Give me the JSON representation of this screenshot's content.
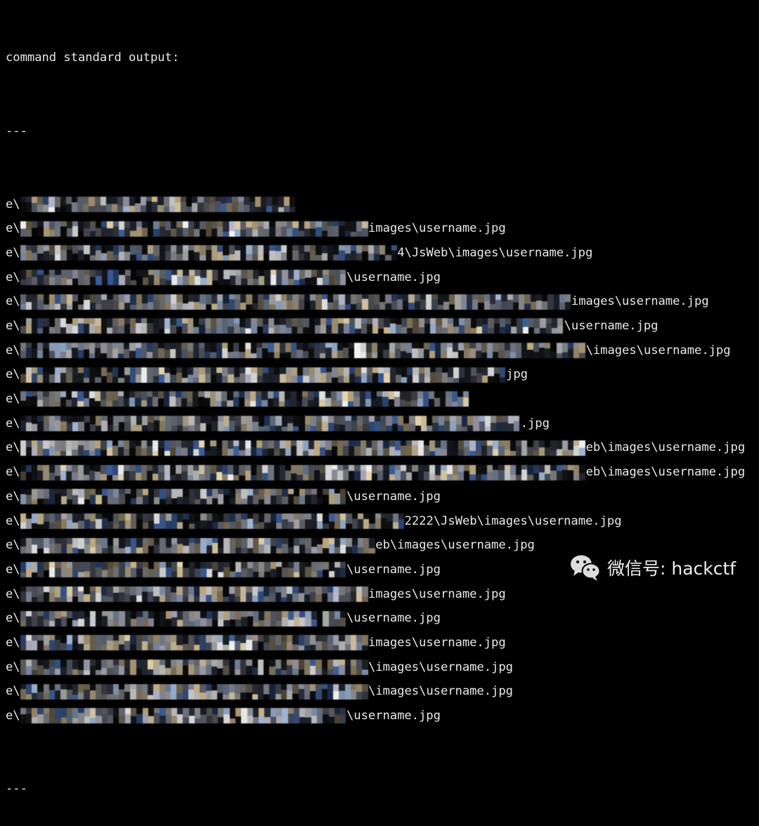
{
  "terminal": {
    "header": "command standard output:",
    "separator": "---",
    "lines": [
      {
        "prefix": "e\\",
        "suffix": ""
      },
      {
        "prefix": "e\\",
        "suffix": "images\\username.jpg"
      },
      {
        "prefix": "e\\",
        "suffix": "4\\JsWeb\\images\\username.jpg"
      },
      {
        "prefix": "e\\",
        "suffix": "\\username.jpg"
      },
      {
        "prefix": "e\\",
        "suffix": "images\\username.jpg"
      },
      {
        "prefix": "e\\",
        "suffix": "\\username.jpg"
      },
      {
        "prefix": "e\\",
        "suffix": "\\images\\username.jpg"
      },
      {
        "prefix": "e\\",
        "suffix": "jpg"
      },
      {
        "prefix": "e\\",
        "suffix": ""
      },
      {
        "prefix": "e\\",
        "suffix": ".jpg"
      },
      {
        "prefix": "e\\",
        "suffix": "eb\\images\\username.jpg"
      },
      {
        "prefix": "e\\",
        "suffix": "eb\\images\\username.jpg"
      },
      {
        "prefix": "e\\",
        "suffix": "\\username.jpg"
      },
      {
        "prefix": "e\\",
        "suffix": "2222\\JsWeb\\images\\username.jpg"
      },
      {
        "prefix": "e\\",
        "suffix": "eb\\images\\username.jpg"
      },
      {
        "prefix": "e\\",
        "suffix": "\\username.jpg"
      },
      {
        "prefix": "e\\",
        "suffix": "images\\username.jpg"
      },
      {
        "prefix": "e\\",
        "suffix": "\\username.jpg"
      },
      {
        "prefix": "e\\",
        "suffix": "images\\username.jpg"
      },
      {
        "prefix": "e\\",
        "suffix": "\\images\\username.jpg"
      },
      {
        "prefix": "e\\",
        "suffix": "\\images\\username.jpg"
      },
      {
        "prefix": "e\\",
        "suffix": "\\username.jpg"
      }
    ],
    "footer": "---"
  },
  "watermark": {
    "icon": "wechat-icon",
    "text": "微信号: hackctf"
  }
}
